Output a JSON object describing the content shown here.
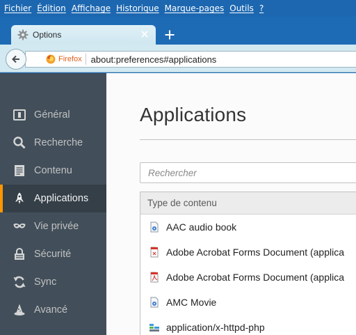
{
  "menu": [
    "Fichier",
    "Édition",
    "Affichage",
    "Historique",
    "Marque-pages",
    "Outils",
    "?"
  ],
  "tab": {
    "title": "Options"
  },
  "nav": {
    "identity_label": "Firefox",
    "url": "about:preferences#applications"
  },
  "sidebar": {
    "items": [
      {
        "label": "Général",
        "icon": "general-icon"
      },
      {
        "label": "Recherche",
        "icon": "search-icon"
      },
      {
        "label": "Contenu",
        "icon": "content-icon"
      },
      {
        "label": "Applications",
        "icon": "applications-icon",
        "selected": true
      },
      {
        "label": "Vie privée",
        "icon": "privacy-mask-icon"
      },
      {
        "label": "Sécurité",
        "icon": "security-lock-icon"
      },
      {
        "label": "Sync",
        "icon": "sync-icon"
      },
      {
        "label": "Avancé",
        "icon": "advanced-wizard-icon"
      }
    ]
  },
  "main": {
    "title": "Applications",
    "search_placeholder": "Rechercher",
    "table": {
      "column_header": "Type de contenu",
      "rows": [
        {
          "label": "AAC audio book",
          "icon": "media-file-icon"
        },
        {
          "label": "Adobe Acrobat Forms Document (applica",
          "icon": "pdf-form-icon"
        },
        {
          "label": "Adobe Acrobat Forms Document (applica",
          "icon": "pdf-icon"
        },
        {
          "label": "AMC Movie",
          "icon": "media-file-icon"
        },
        {
          "label": "application/x-httpd-php",
          "icon": "generic-app-icon"
        }
      ]
    }
  },
  "colors": {
    "accent": "#ff9500",
    "sidebar_bg": "#424f5a",
    "titlebar": "#1d6bb5"
  }
}
